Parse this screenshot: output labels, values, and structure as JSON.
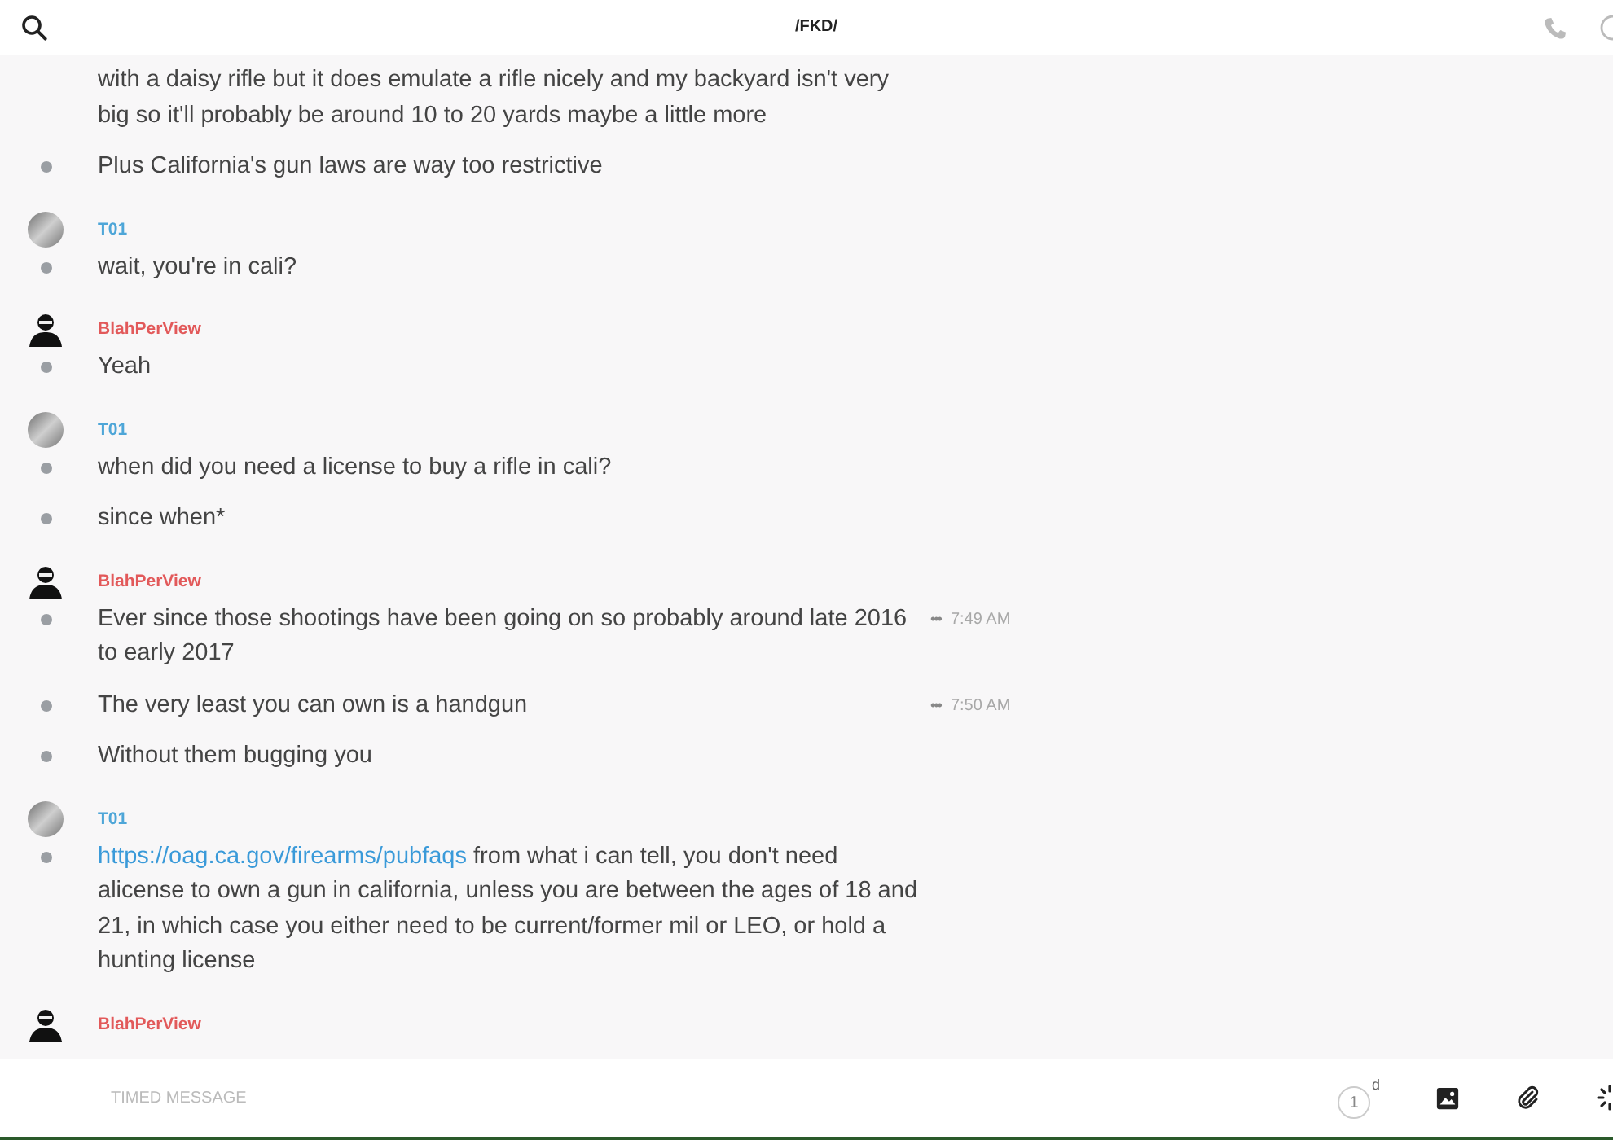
{
  "header": {
    "title": "/FKD/"
  },
  "groups": [
    {
      "kind": "continuation",
      "messages": [
        {
          "text": "with a daisy rifle but it does emulate a rifle nicely and my backyard isn't very big so it'll probably be around 10 to 20 yards maybe a little more"
        },
        {
          "text": "Plus California's gun laws are way too restrictive"
        }
      ]
    },
    {
      "author": "T01",
      "color": "#4ea6d8",
      "kind": "photo",
      "messages": [
        {
          "text": "wait, you're in cali?"
        }
      ]
    },
    {
      "author": "BlahPerView",
      "color": "#e2595a",
      "kind": "silhouette",
      "messages": [
        {
          "text": "Yeah"
        }
      ]
    },
    {
      "author": "T01",
      "color": "#4ea6d8",
      "kind": "photo",
      "messages": [
        {
          "text": "when did you need a license to buy a rifle in cali?"
        },
        {
          "text": "since when*"
        }
      ]
    },
    {
      "author": "BlahPerView",
      "color": "#e2595a",
      "kind": "silhouette",
      "messages": [
        {
          "text": "Ever since those shootings have been going on so probably around late 2016 to early 2017",
          "more": "•••",
          "time": "7:49 AM"
        },
        {
          "text": "The very least you can own is a handgun",
          "more": "•••",
          "time": "7:50 AM"
        },
        {
          "text": "Without them bugging you"
        }
      ]
    },
    {
      "author": "T01",
      "color": "#4ea6d8",
      "kind": "photo",
      "messages": [
        {
          "link": "https://oag.ca.gov/firearms/pubfaqs",
          "text": " from what i can tell, you don't need alicense to own a gun in california, unless you are between the ages of 18 and 21, in which case you either need to be current/former mil or LEO, or hold a hunting license"
        }
      ]
    },
    {
      "author": "BlahPerView",
      "color": "#e2595a",
      "kind": "silhouette"
    }
  ],
  "composer": {
    "placeholder": "TIMED MESSAGE",
    "timer": {
      "value": "1",
      "unit": "d"
    }
  }
}
